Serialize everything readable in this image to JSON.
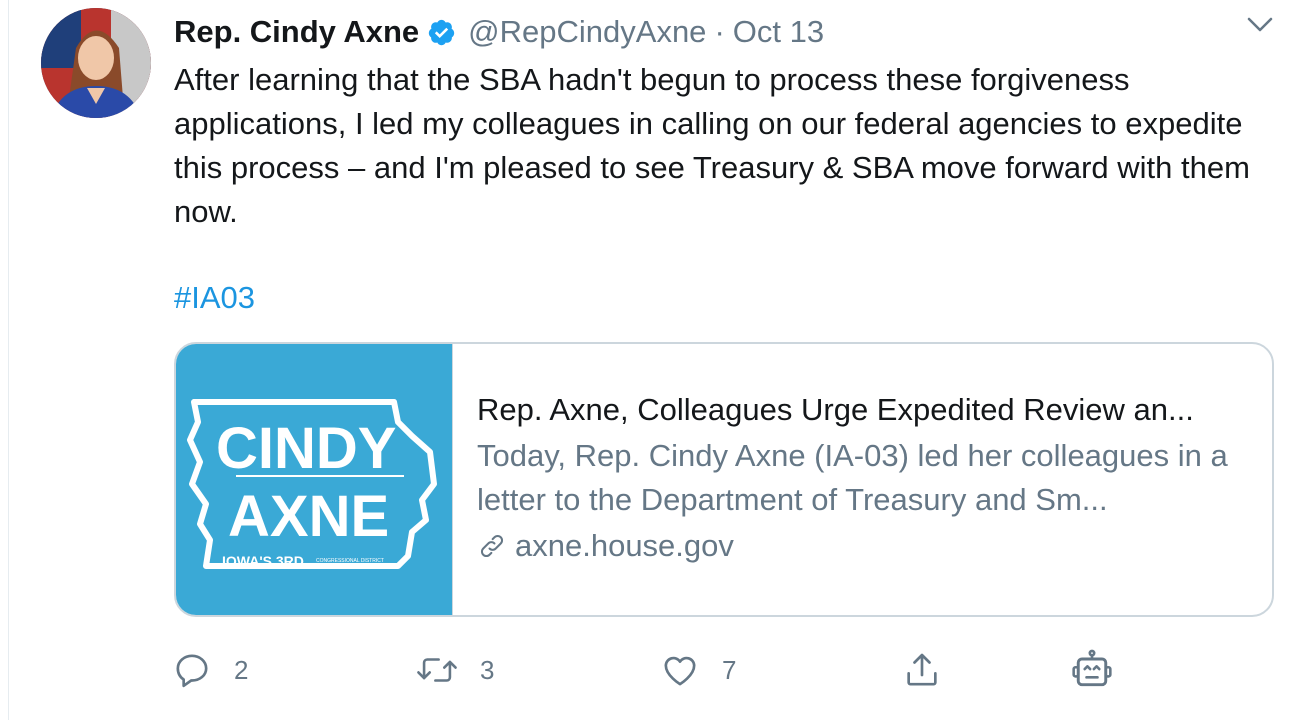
{
  "tweet": {
    "author_name": "Rep. Cindy Axne",
    "handle": "@RepCindyAxne",
    "separator": "·",
    "date": "Oct 13",
    "text": "After learning that the SBA hadn't begun to process these forgiveness applications, I led my colleagues in calling on our federal agencies to expedite this process – and I'm pleased to see Treasury & SBA move forward with them now.",
    "hashtag": "#IA03"
  },
  "card": {
    "logo_line1": "CINDY",
    "logo_line2": "AXNE",
    "logo_sub": "IOWA'S 3RD",
    "logo_small": "CONGRESSIONAL DISTRICT",
    "title": "Rep. Axne, Colleagues Urge Expedited Review an...",
    "description": "Today, Rep. Cindy Axne (IA-03) led her colleagues in a letter to the Department of Treasury and Sm...",
    "domain": "axne.house.gov"
  },
  "actions": {
    "reply_count": "2",
    "retweet_count": "3",
    "like_count": "7"
  },
  "icons": {
    "verified": "verified-badge-icon",
    "caret": "chevron-down-icon",
    "reply": "reply-icon",
    "retweet": "retweet-icon",
    "like": "heart-icon",
    "share": "share-icon",
    "bot": "bot-icon",
    "link": "link-icon"
  },
  "colors": {
    "accent": "#1b95e0",
    "secondary_text": "#657786",
    "card_image_bg": "#3aa9d6"
  }
}
